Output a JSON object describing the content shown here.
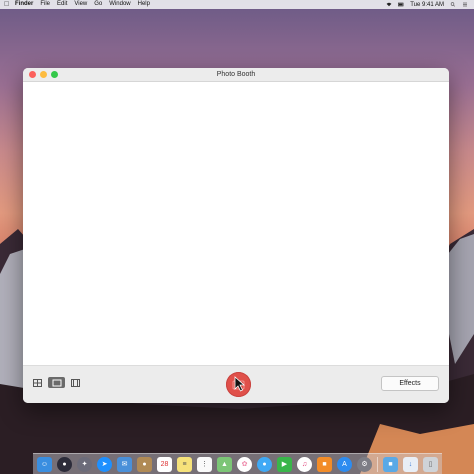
{
  "menubar": {
    "app": "Finder",
    "items": [
      "File",
      "Edit",
      "View",
      "Go",
      "Window",
      "Help"
    ],
    "clock": "Tue 9:41 AM"
  },
  "window": {
    "title": "Photo Booth",
    "effects_label": "Effects"
  },
  "dock": {
    "calendar_day": "28",
    "icons": [
      "finder-icon",
      "siri-icon",
      "launchpad-icon",
      "safari-icon",
      "mail-icon",
      "contacts-icon",
      "calendar-icon",
      "notes-icon",
      "reminders-icon",
      "maps-icon",
      "photos-icon",
      "messages-icon",
      "facetime-icon",
      "itunes-icon",
      "ibooks-icon",
      "app-store-icon",
      "system-preferences-icon",
      "folder-icon",
      "downloads-icon",
      "trash-icon"
    ]
  },
  "colors": {
    "shutter": "#e0504a",
    "close": "#fc605c",
    "minimize": "#fdbc40",
    "zoom": "#34c84a"
  }
}
